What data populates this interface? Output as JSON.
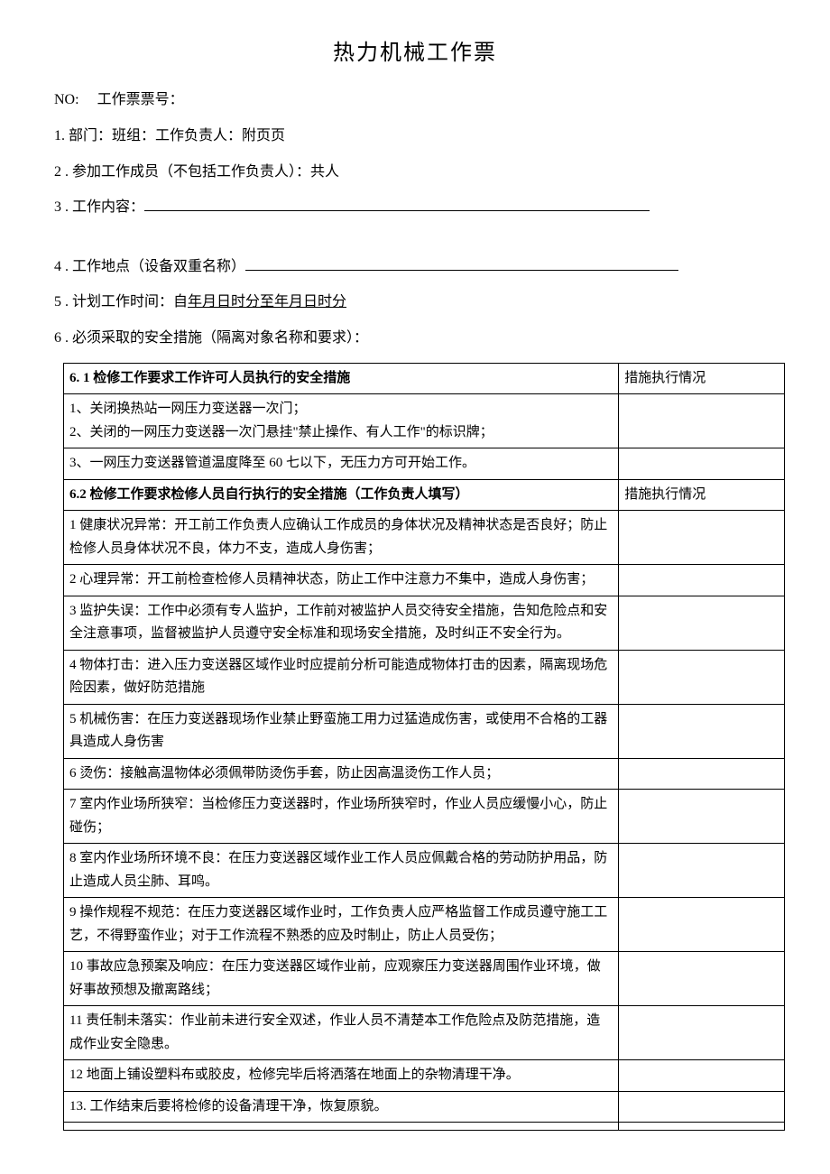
{
  "title": "热力机械工作票",
  "header": {
    "no_label": "NO:",
    "ticket_label": "工作票票号："
  },
  "fields": {
    "item1": "1. 部门：班组：工作负责人：附页页",
    "item2": "2  . 参加工作成员（不包括工作负责人）：共人",
    "item3_label": "3  . 工作内容：",
    "item4_label": "4  . 工作地点（设备双重名称）",
    "item5_prefix": "5  . 计划工作时间：自",
    "item5_underline": "年月日时分至年月日时分",
    "item6": "6  . 必须采取的安全措施（隔离对象名称和要求）："
  },
  "table": {
    "section1_header": "6. 1 检修工作要求工作许可人员执行的安全措施",
    "status_header": "措施执行情况",
    "section1_rows": [
      "1、关闭换热站一网压力变送器一次门；\n2、关闭的一网压力变送器一次门悬挂\"禁止操作、有人工作\"的标识牌；",
      "3、一网压力变送器管道温度降至 60 七以下，无压力方可开始工作。"
    ],
    "section2_header": "6.2 检修工作要求检修人员自行执行的安全措施（工作负责人填写）",
    "section2_rows": [
      "1 健康状况异常：开工前工作负责人应确认工作成员的身体状况及精神状态是否良好；防止检修人员身体状况不良，体力不支，造成人身伤害；",
      "2 心理异常：开工前检查检修人员精神状态，防止工作中注意力不集中，造成人身伤害；",
      "3 监护失误：工作中必须有专人监护，工作前对被监护人员交待安全措施，告知危险点和安全注意事项，监督被监护人员遵守安全标准和现场安全措施，及时纠正不安全行为。",
      "4 物体打击：进入压力变送器区域作业时应提前分析可能造成物体打击的因素，隔离现场危险因素，做好防范措施",
      "5 机械伤害：在压力变送器现场作业禁止野蛮施工用力过猛造成伤害，或使用不合格的工器具造成人身伤害",
      "6 烫伤：接触高温物体必须佩带防烫伤手套，防止因高温烫伤工作人员；",
      "7 室内作业场所狭窄：当检修压力变送器时，作业场所狭窄时，作业人员应缓慢小心，防止碰伤；",
      "8 室内作业场所环境不良：在压力变送器区域作业工作人员应佩戴合格的劳动防护用品，防止造成人员尘肺、耳鸣。",
      "9 操作规程不规范：在压力变送器区域作业时，工作负责人应严格监督工作成员遵守施工工艺，不得野蛮作业；对于工作流程不熟悉的应及时制止，防止人员受伤；",
      "10 事故应急预案及响应：在压力变送器区域作业前，应观察压力变送器周围作业环境，做好事故预想及撤离路线；",
      "11 责任制未落实：作业前未进行安全双述，作业人员不清楚本工作危险点及防范措施，造成作业安全隐患。",
      "12 地面上铺设塑料布或胶皮，检修完毕后将洒落在地面上的杂物清理干净。",
      "13. 工作结束后要将检修的设备清理干净，恢复原貌。",
      ""
    ]
  }
}
